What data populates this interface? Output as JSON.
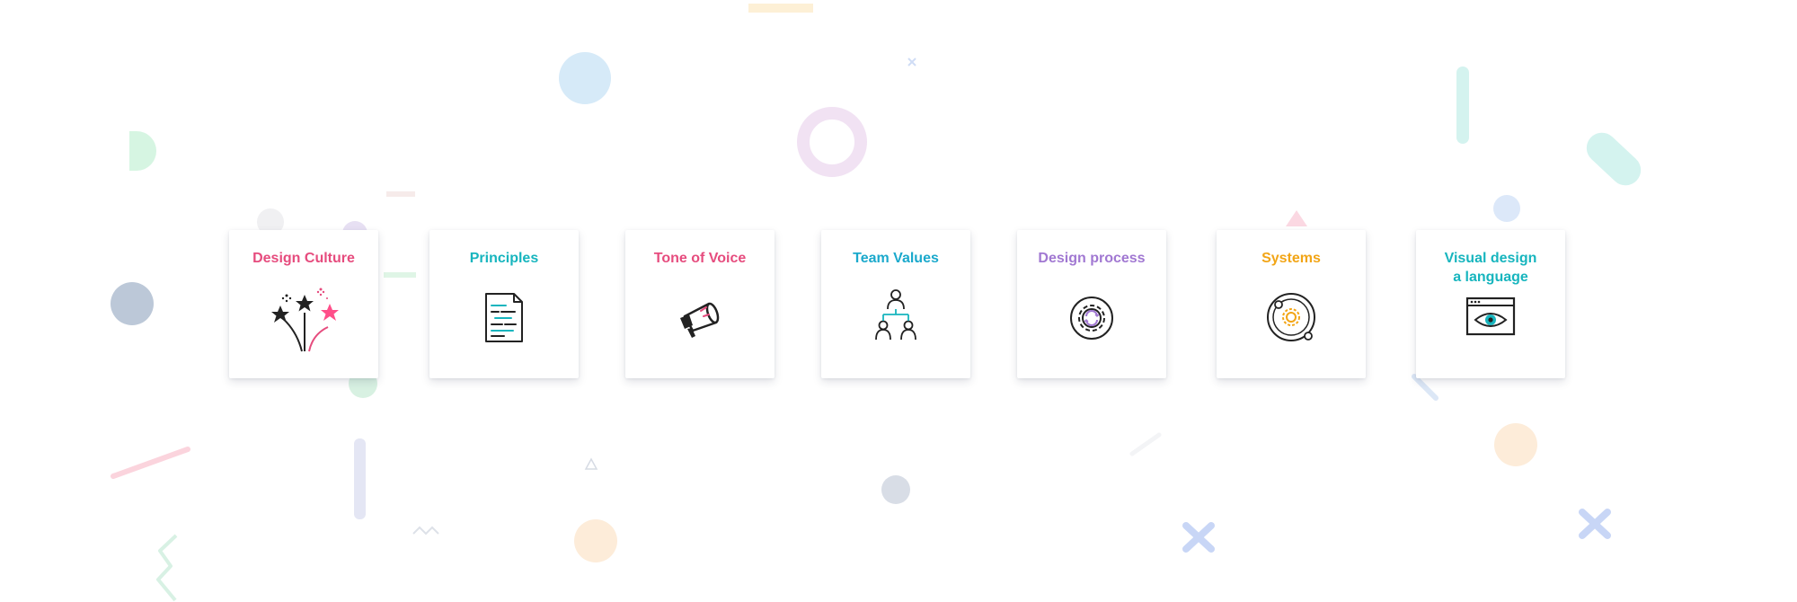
{
  "cards": [
    {
      "title": "Design Culture",
      "color": "#e64c7e",
      "icon": "fireworks-icon"
    },
    {
      "title": "Principles",
      "color": "#17b5be",
      "icon": "document-icon"
    },
    {
      "title": "Tone of Voice",
      "color": "#e64c7e",
      "icon": "megaphone-icon"
    },
    {
      "title": "Team Values",
      "color": "#1ba9cc",
      "icon": "org-chart-icon"
    },
    {
      "title": "Design process",
      "color": "#a178d2",
      "icon": "gear-icon"
    },
    {
      "title": "Systems",
      "color": "#f2a516",
      "icon": "orbit-icon"
    },
    {
      "title_line1": "Visual design",
      "title_line2": "a language",
      "color": "#17b5be",
      "icon": "browser-eye-icon"
    }
  ]
}
